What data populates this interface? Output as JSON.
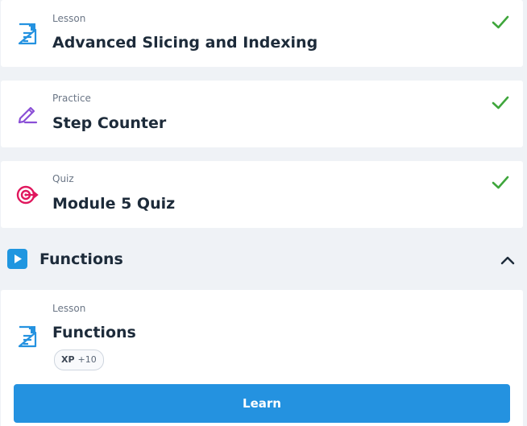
{
  "items": [
    {
      "type": "Lesson",
      "title": "Advanced Slicing and Indexing",
      "icon": "lesson-icon",
      "completed": true
    },
    {
      "type": "Practice",
      "title": "Step Counter",
      "icon": "pencil-icon",
      "completed": true
    },
    {
      "type": "Quiz",
      "title": "Module 5 Quiz",
      "icon": "target-icon",
      "completed": true
    }
  ],
  "section": {
    "title": "Functions",
    "expanded": true,
    "icon": "play-icon",
    "lesson": {
      "type": "Lesson",
      "title": "Functions",
      "xp_label": "XP",
      "xp_value": "+10",
      "button_label": "Learn"
    }
  },
  "colors": {
    "check": "#3fa63c",
    "lesson_icon": "#2492e0",
    "practice_icon": "#8a4fd6",
    "quiz_icon": "#e0175d",
    "button": "#2492e0"
  }
}
